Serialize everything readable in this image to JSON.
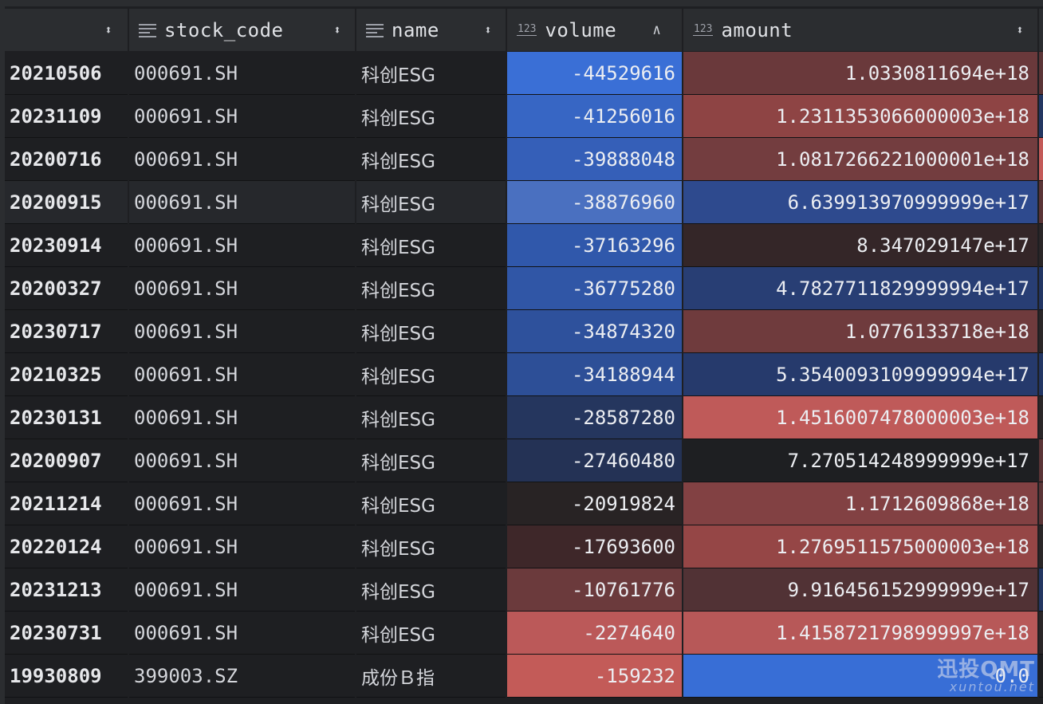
{
  "header": {
    "index_label": "",
    "columns": [
      {
        "label": "stock_code",
        "icon": "text-column-icon"
      },
      {
        "label": "name",
        "icon": "text-column-icon"
      },
      {
        "label": "volume",
        "icon": "numeric-column-icon",
        "sort": "ascending"
      },
      {
        "label": "amount",
        "icon": "numeric-column-icon"
      }
    ],
    "numeric_icon_text": "123"
  },
  "rows": [
    {
      "index": "20210506",
      "stock_code": "000691.SH",
      "name": "科创ESG",
      "volume": "-44529616",
      "amount": "1.0330811694e+18",
      "vol_color": "#3a6fd6",
      "amt_color": "#6a393b",
      "edge_color": "#5a3436"
    },
    {
      "index": "20231109",
      "stock_code": "000691.SH",
      "name": "科创ESG",
      "volume": "-41256016",
      "amount": "1.2311353066000003e+18",
      "vol_color": "#3766c4",
      "amt_color": "#8e4444",
      "edge_color": "#233661"
    },
    {
      "index": "20200716",
      "stock_code": "000691.SH",
      "name": "科创ESG",
      "volume": "-39888048",
      "amount": "1.0817266221000001e+18",
      "vol_color": "#355fb8",
      "amt_color": "#733d3f",
      "edge_color": "#c35a58"
    },
    {
      "index": "20200915",
      "stock_code": "000691.SH",
      "name": "科创ESG",
      "volume": "-38876960",
      "amount": "6.639913970999999e+17",
      "vol_color": "#4a70c0",
      "amt_color": "#2e4a8e",
      "edge_color": "#5a3436"
    },
    {
      "index": "20230914",
      "stock_code": "000691.SH",
      "name": "科创ESG",
      "volume": "-37163296",
      "amount": "8.347029147e+17",
      "vol_color": "#3058ab",
      "amt_color": "#342628",
      "edge_color": "#2a2628"
    },
    {
      "index": "20200327",
      "stock_code": "000691.SH",
      "name": "科创ESG",
      "volume": "-36775280",
      "amount": "4.7827711829999994e+17",
      "vol_color": "#3056a6",
      "amt_color": "#283e74",
      "edge_color": "#223563"
    },
    {
      "index": "20230717",
      "stock_code": "000691.SH",
      "name": "科创ESG",
      "volume": "-34874320",
      "amount": "1.0776133718e+18",
      "vol_color": "#2e519c",
      "amt_color": "#6f3b3d",
      "edge_color": "#2a2628"
    },
    {
      "index": "20210325",
      "stock_code": "000691.SH",
      "name": "科创ESG",
      "volume": "-34188944",
      "amount": "5.3540093109999994e+17",
      "vol_color": "#2d4f97",
      "amt_color": "#263a6c",
      "edge_color": "#223563"
    },
    {
      "index": "20230131",
      "stock_code": "000691.SH",
      "name": "科创ESG",
      "volume": "-28587280",
      "amount": "1.4516007478000003e+18",
      "vol_color": "#25365e",
      "amt_color": "#bf5a59",
      "edge_color": "#2a2628"
    },
    {
      "index": "20200907",
      "stock_code": "000691.SH",
      "name": "科创ESG",
      "volume": "-27460480",
      "amount": "7.270514248999999e+17",
      "vol_color": "#243255",
      "amt_color": "#1e1f22",
      "edge_color": "#5a3436"
    },
    {
      "index": "20211214",
      "stock_code": "000691.SH",
      "name": "科创ESG",
      "volume": "-20919824",
      "amount": "1.1712609868e+18",
      "vol_color": "#282324",
      "amt_color": "#824143",
      "edge_color": "#5a3436"
    },
    {
      "index": "20220124",
      "stock_code": "000691.SH",
      "name": "科创ESG",
      "volume": "-17693600",
      "amount": "1.2769511575000003e+18",
      "vol_color": "#3e2729",
      "amt_color": "#954646",
      "edge_color": "#2a2628"
    },
    {
      "index": "20231213",
      "stock_code": "000691.SH",
      "name": "科创ESG",
      "volume": "-10761776",
      "amount": "9.916456152999999e+17",
      "vol_color": "#6b3a3c",
      "amt_color": "#513235",
      "edge_color": "#233661"
    },
    {
      "index": "20230731",
      "stock_code": "000691.SH",
      "name": "科创ESG",
      "volume": "-2274640",
      "amount": "1.4158721798999997e+18",
      "vol_color": "#bb5959",
      "amt_color": "#b75858",
      "edge_color": "#2a2628"
    },
    {
      "index": "19930809",
      "stock_code": "399003.SZ",
      "name": "成份Ｂ指",
      "volume": "-159232",
      "amount": "0.0",
      "vol_color": "#c35b58",
      "amt_color": "#386ed6",
      "edge_color": "#1e1f22"
    }
  ],
  "highlighted_row": 3,
  "watermark": {
    "main": "迅投QMT",
    "sub": "xuntou.net"
  }
}
